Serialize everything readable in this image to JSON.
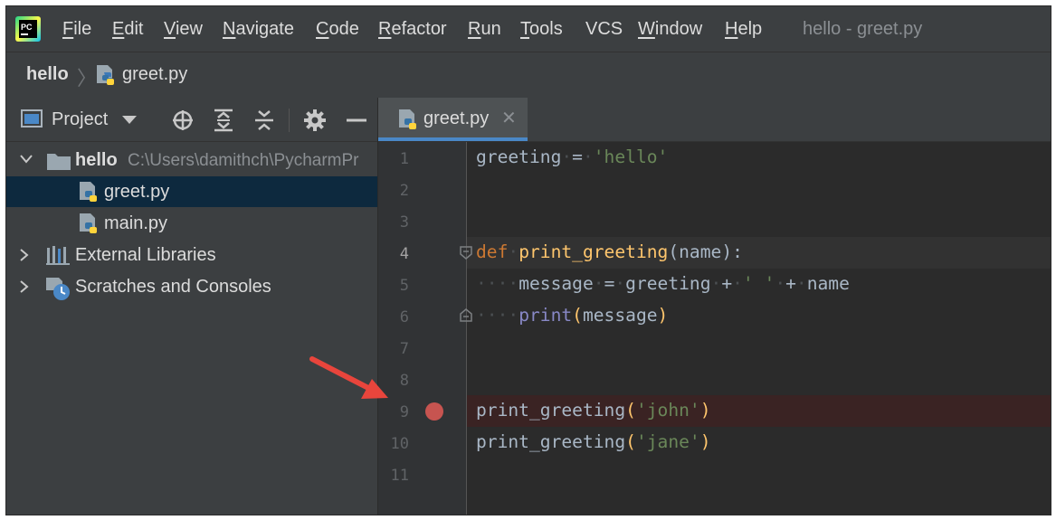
{
  "app": {
    "logo_text": "PC",
    "window_title": "hello - greet.py"
  },
  "menu": [
    {
      "u": "F",
      "rest": "ile"
    },
    {
      "u": "E",
      "rest": "dit"
    },
    {
      "u": "V",
      "rest": "iew"
    },
    {
      "u": "N",
      "rest": "avigate"
    },
    {
      "u": "C",
      "rest": "ode"
    },
    {
      "u": "R",
      "rest": "efactor"
    },
    {
      "u": "R",
      "rest": "un"
    },
    {
      "u": "T",
      "rest": "ools"
    },
    {
      "u": "",
      "rest": "VCS"
    },
    {
      "u": "W",
      "rest": "indow"
    },
    {
      "u": "H",
      "rest": "elp"
    }
  ],
  "breadcrumb": {
    "root": "hello",
    "file": "greet.py"
  },
  "project_panel": {
    "title": "Project",
    "tree": [
      {
        "label": "hello",
        "path": "C:\\Users\\damithch\\PycharmPr",
        "type": "folder",
        "expanded": true
      },
      {
        "label": "greet.py",
        "type": "python",
        "selected": true
      },
      {
        "label": "main.py",
        "type": "python"
      },
      {
        "label": "External Libraries",
        "type": "libraries"
      },
      {
        "label": "Scratches and Consoles",
        "type": "scratches"
      }
    ]
  },
  "editor": {
    "tab_label": "greet.py",
    "tab_close": "✕",
    "line_numbers": [
      "1",
      "2",
      "3",
      "4",
      "5",
      "6",
      "7",
      "8",
      "9",
      "10",
      "11"
    ],
    "lines": {
      "l1_var": "greeting",
      "l1_eq": "=",
      "l1_str": "'hello'",
      "l4_def": "def",
      "l4_fn": "print_greeting",
      "l4_open": "(",
      "l4_param": "name",
      "l4_close": "):",
      "l5_var": "message",
      "l5_eq": "=",
      "l5_greeting": "greeting",
      "l5_plus1": "+",
      "l5_str": "' '",
      "l5_plus2": "+",
      "l5_name": "name",
      "l6_print": "print",
      "l6_open": "(",
      "l6_arg": "message",
      "l6_close": ")",
      "l9_fn": "print_greeting",
      "l9_open": "(",
      "l9_str": "'john'",
      "l9_close": ")",
      "l10_fn": "print_greeting",
      "l10_open": "(",
      "l10_str": "'jane'",
      "l10_close": ")"
    },
    "active_line": 4,
    "breakpoint_line": 9
  },
  "colors": {
    "accent": "#4a88c7",
    "breakpoint": "#c75450",
    "keyword": "#cc7832",
    "function": "#ffc66d",
    "string": "#6a8759",
    "builtin": "#8888c6",
    "annotation_arrow": "#e8453c"
  }
}
